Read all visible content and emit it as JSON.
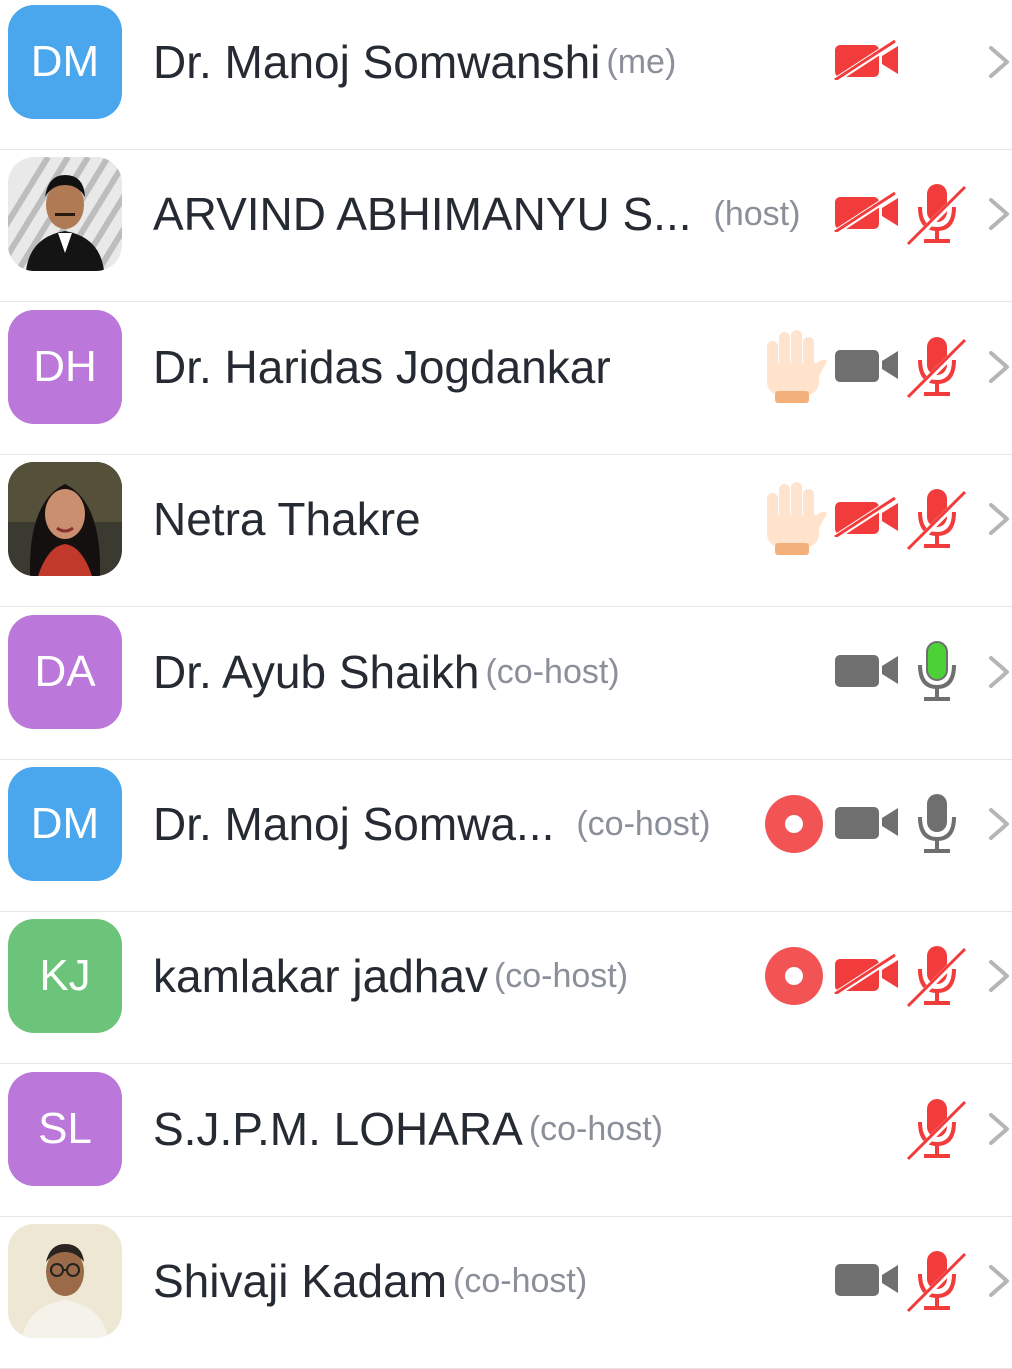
{
  "participants": [
    {
      "initials": "DM",
      "avatar_color": "#4aa7ee",
      "avatar_type": "initials",
      "name": "Dr. Manoj Somwanshi",
      "role": "(me)",
      "hand_raised": false,
      "recording": false,
      "video": "off",
      "mic": "none"
    },
    {
      "initials": "",
      "avatar_type": "photo",
      "name": "ARVIND ABHIMANYU S...",
      "role": "(host)",
      "hand_raised": false,
      "recording": false,
      "video": "off",
      "mic": "muted"
    },
    {
      "initials": "DH",
      "avatar_color": "#bb77d9",
      "avatar_type": "initials",
      "name": "Dr. Haridas Jogdankar",
      "role": "",
      "hand_raised": true,
      "recording": false,
      "video": "on",
      "mic": "muted"
    },
    {
      "initials": "",
      "avatar_type": "photo",
      "name": "Netra Thakre",
      "role": "",
      "hand_raised": true,
      "recording": false,
      "video": "off",
      "mic": "muted"
    },
    {
      "initials": "DA",
      "avatar_color": "#bb77d9",
      "avatar_type": "initials",
      "name": "Dr. Ayub Shaikh",
      "role": "(co-host)",
      "hand_raised": false,
      "recording": false,
      "video": "on",
      "mic": "speaking"
    },
    {
      "initials": "DM",
      "avatar_color": "#4aa7ee",
      "avatar_type": "initials",
      "name": "Dr. Manoj Somwa...",
      "role": "(co-host)",
      "hand_raised": false,
      "recording": true,
      "video": "on",
      "mic": "on"
    },
    {
      "initials": "KJ",
      "avatar_color": "#6cc47a",
      "avatar_type": "initials",
      "name": "kamlakar jadhav",
      "role": "(co-host)",
      "hand_raised": false,
      "recording": true,
      "video": "off",
      "mic": "muted"
    },
    {
      "initials": "SL",
      "avatar_color": "#bb77d9",
      "avatar_type": "initials",
      "name": "S.J.P.M. LOHARA",
      "role": "(co-host)",
      "hand_raised": false,
      "recording": false,
      "video": "none",
      "mic": "muted"
    },
    {
      "initials": "",
      "avatar_type": "photo",
      "name": "Shivaji Kadam",
      "role": "(co-host)",
      "hand_raised": false,
      "recording": false,
      "video": "on",
      "mic": "muted"
    }
  ],
  "colors": {
    "muted_red": "#f23c3c",
    "icon_gray": "#6f6f6f",
    "speaking_green": "#4cd137",
    "record_red": "#f25454",
    "chevron_gray": "#b5b5b5",
    "hand_skin": "#ffe3cc"
  }
}
